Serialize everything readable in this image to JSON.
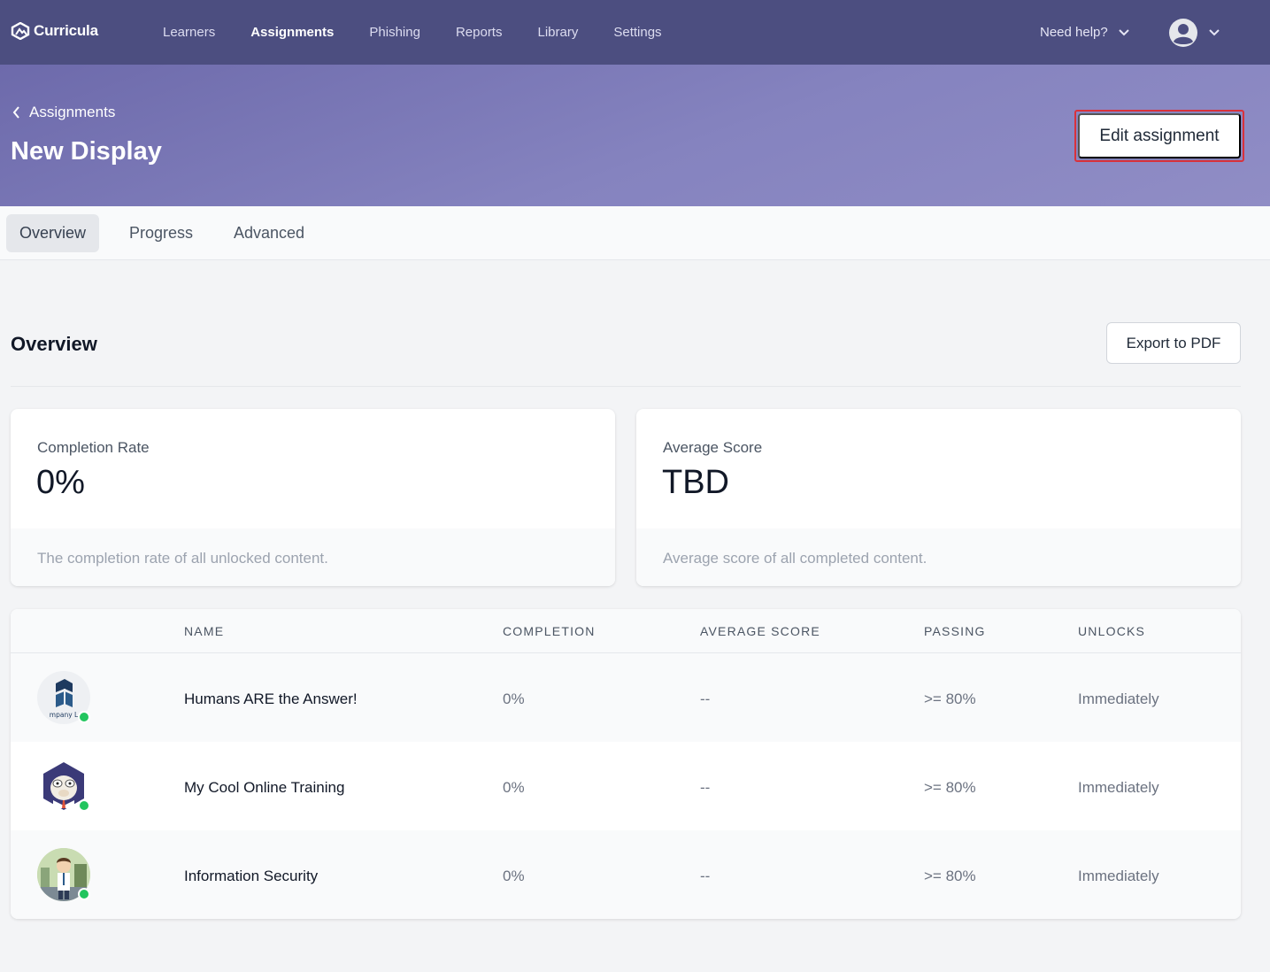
{
  "brand": {
    "name": "Curricula"
  },
  "nav": {
    "items": [
      {
        "label": "Learners"
      },
      {
        "label": "Assignments"
      },
      {
        "label": "Phishing"
      },
      {
        "label": "Reports"
      },
      {
        "label": "Library"
      },
      {
        "label": "Settings"
      }
    ],
    "help_label": "Need help?"
  },
  "header": {
    "breadcrumb": "Assignments",
    "title": "New Display",
    "edit_button": "Edit assignment"
  },
  "tabs": [
    {
      "label": "Overview"
    },
    {
      "label": "Progress"
    },
    {
      "label": "Advanced"
    }
  ],
  "overview": {
    "title": "Overview",
    "export_button": "Export to PDF",
    "cards": [
      {
        "label": "Completion Rate",
        "value": "0%",
        "description": "The completion rate of all unlocked content."
      },
      {
        "label": "Average Score",
        "value": "TBD",
        "description": "Average score of all completed content."
      }
    ]
  },
  "table": {
    "columns": [
      "NAME",
      "COMPLETION",
      "AVERAGE SCORE",
      "PASSING",
      "UNLOCKS"
    ],
    "rows": [
      {
        "name": "Humans ARE the Answer!",
        "completion": "0%",
        "average_score": "--",
        "passing": ">= 80%",
        "unlocks": "Immediately",
        "thumb_caption": "mpany L"
      },
      {
        "name": "My Cool Online Training",
        "completion": "0%",
        "average_score": "--",
        "passing": ">= 80%",
        "unlocks": "Immediately"
      },
      {
        "name": "Information Security",
        "completion": "0%",
        "average_score": "--",
        "passing": ">= 80%",
        "unlocks": "Immediately"
      }
    ]
  },
  "colors": {
    "nav_bg": "#4c4e80",
    "hero_gradient": [
      "#6d6aab",
      "#908dc5"
    ],
    "highlight_border": "#d9313b",
    "status_dot": "#22c55e"
  }
}
